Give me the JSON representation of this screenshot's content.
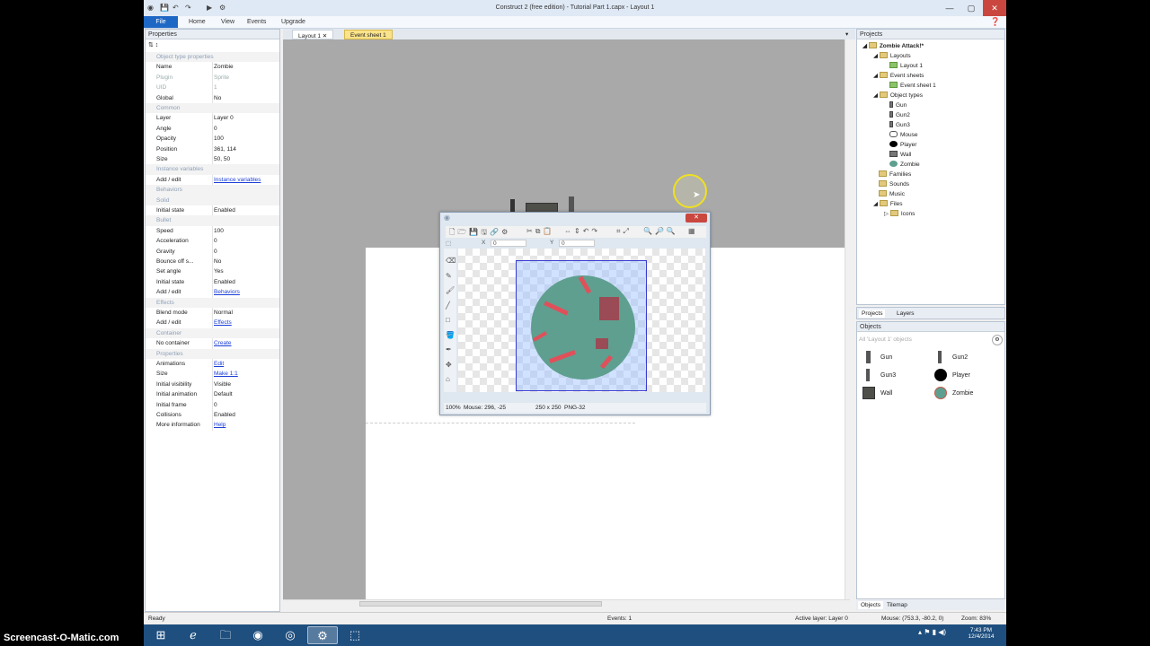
{
  "window": {
    "title": "Construct 2  (free edition) - Tutorial Part 1.capx - Layout 1"
  },
  "menu": {
    "file": "File",
    "home": "Home",
    "view": "View",
    "events": "Events",
    "upgrade": "Upgrade"
  },
  "properties": {
    "title": "Properties",
    "rows": [
      {
        "k": "Object type properties",
        "v": "",
        "type": "cat"
      },
      {
        "k": "Name",
        "v": "Zombie"
      },
      {
        "k": "Plugin",
        "v": "Sprite",
        "type": "dim"
      },
      {
        "k": "UID",
        "v": "1",
        "type": "dim"
      },
      {
        "k": "Global",
        "v": "No"
      },
      {
        "k": "Common",
        "v": "",
        "type": "cat"
      },
      {
        "k": "Layer",
        "v": "Layer 0"
      },
      {
        "k": "Angle",
        "v": "0"
      },
      {
        "k": "Opacity",
        "v": "100"
      },
      {
        "k": "Position",
        "v": "361, 114"
      },
      {
        "k": "Size",
        "v": "50, 50"
      },
      {
        "k": "Instance variables",
        "v": "",
        "type": "cat"
      },
      {
        "k": "Add / edit",
        "v": "Instance variables",
        "type": "link"
      },
      {
        "k": "Behaviors",
        "v": "",
        "type": "cat"
      },
      {
        "k": "Solid",
        "v": "",
        "type": "cat"
      },
      {
        "k": "Initial state",
        "v": "Enabled"
      },
      {
        "k": "Bullet",
        "v": "",
        "type": "cat"
      },
      {
        "k": "Speed",
        "v": "100"
      },
      {
        "k": "Acceleration",
        "v": "0"
      },
      {
        "k": "Gravity",
        "v": "0"
      },
      {
        "k": "Bounce off s...",
        "v": "No"
      },
      {
        "k": "Set angle",
        "v": "Yes"
      },
      {
        "k": "Initial state",
        "v": "Enabled"
      },
      {
        "k": "Add / edit",
        "v": "Behaviors",
        "type": "link"
      },
      {
        "k": "Effects",
        "v": "",
        "type": "cat"
      },
      {
        "k": "Blend mode",
        "v": "Normal"
      },
      {
        "k": "Add / edit",
        "v": "Effects",
        "type": "link"
      },
      {
        "k": "Container",
        "v": "",
        "type": "cat"
      },
      {
        "k": "No container",
        "v": "Create",
        "type": "link"
      },
      {
        "k": "Properties",
        "v": "",
        "type": "cat"
      },
      {
        "k": "Animations",
        "v": "Edit",
        "type": "link"
      },
      {
        "k": "Size",
        "v": "Make 1:1",
        "type": "link"
      },
      {
        "k": "Initial visibility",
        "v": "Visible"
      },
      {
        "k": "Initial animation",
        "v": "Default"
      },
      {
        "k": "Initial frame",
        "v": "0"
      },
      {
        "k": "Collisions",
        "v": "Enabled"
      },
      {
        "k": "More information",
        "v": "Help",
        "type": "link"
      }
    ]
  },
  "tabs": {
    "layout": "Layout 1",
    "events": "Event sheet 1"
  },
  "projects": {
    "title": "Projects",
    "root": "Zombie Attack!*",
    "layouts": "Layouts",
    "layout1": "Layout 1",
    "eventsheets": "Event sheets",
    "eventsheet1": "Event sheet 1",
    "objecttypes": "Object types",
    "types": [
      "Gun",
      "Gun2",
      "Gun3",
      "Mouse",
      "Player",
      "Wall",
      "Zombie"
    ],
    "families": "Families",
    "sounds": "Sounds",
    "music": "Music",
    "files": "Files",
    "icons": "Icons",
    "tab_projects": "Projects",
    "tab_layers": "Layers"
  },
  "objects": {
    "title": "Objects",
    "filter": "All 'Layout 1' objects",
    "items": [
      "Gun",
      "Gun2",
      "Gun3",
      "Player",
      "Wall",
      "Zombie"
    ],
    "tab_objects": "Objects",
    "tab_tilemap": "Tilemap"
  },
  "editor": {
    "x_label": "X",
    "x_val": "0",
    "y_label": "Y",
    "y_val": "0",
    "zoom": "100%",
    "mouse": "Mouse: 296, -25",
    "size": "250 x 250",
    "format": "PNG-32"
  },
  "status": {
    "ready": "Ready",
    "events": "Events: 1",
    "layer": "Active layer: Layer 0",
    "mouse": "Mouse: (753.3, -80.2, 0)",
    "zoom": "Zoom: 83%"
  },
  "taskbar": {
    "time": "7:43 PM",
    "date": "12/4/2014"
  },
  "watermark": "Screencast-O-Matic.com",
  "colors": {
    "accent": "#1e67c4",
    "zombie": "#5f9f8f",
    "blood": "#e0505a",
    "canvas_bg": "#a9a9a9"
  }
}
